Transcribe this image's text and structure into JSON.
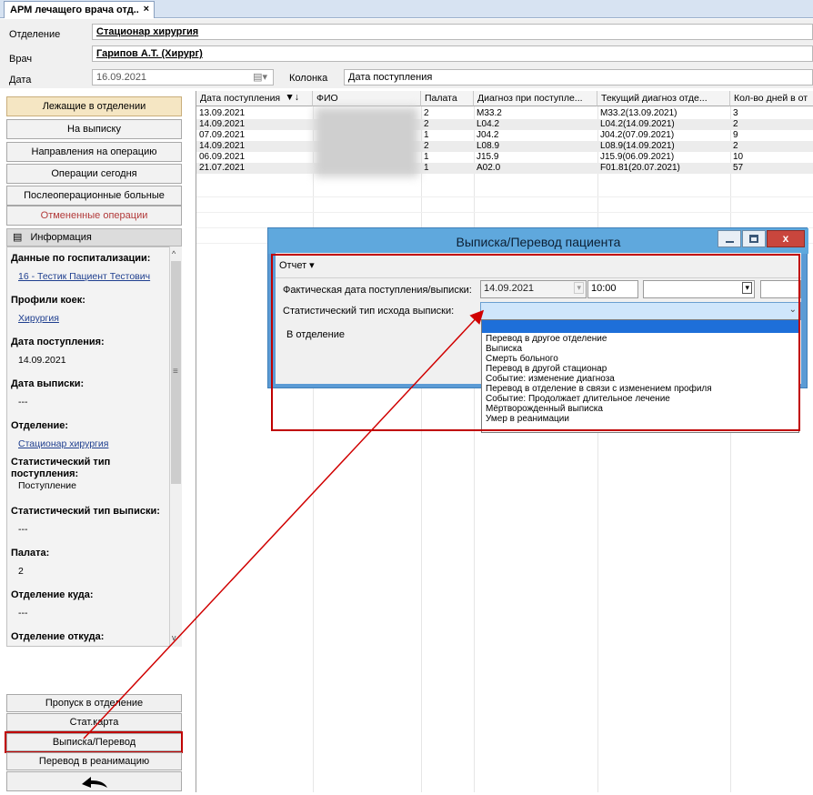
{
  "tab": {
    "title": "АРМ лечащего врача отд..",
    "close": "×"
  },
  "header": {
    "department_label": "Отделение",
    "department_value": "Стационар хирургия",
    "doctor_label": "Врач",
    "doctor_value": "Гарипов А.Т. (Хирург)",
    "date_label": "Дата",
    "date_value": "16.09.2021",
    "column_label": "Колонка",
    "column_value": "Дата поступления"
  },
  "nav": [
    {
      "label": "Лежащие в отделении",
      "state": "active"
    },
    {
      "label": "На выписку"
    },
    {
      "label": "Направления на операцию"
    },
    {
      "label": "Операции сегодня"
    },
    {
      "label": "Послеоперационные больные"
    },
    {
      "label": "Отмененные операции",
      "state": "red"
    }
  ],
  "info": {
    "title": "Информация",
    "fields": [
      {
        "label": "Данные по госпитализации:",
        "value": "16 - Тестик Пациент Тестович",
        "link": true
      },
      {
        "label": "Профили коек:",
        "value": "Хирургия",
        "link": true
      },
      {
        "label": "Дата поступления:",
        "value": "14.09.2021"
      },
      {
        "label": "Дата выписки:",
        "value": "---"
      },
      {
        "label": "Отделение:",
        "value": "Стационар хирургия",
        "link": true
      },
      {
        "label": "Статистический тип поступления:",
        "value": "Поступление"
      },
      {
        "label": "Статистический тип выписки:",
        "value": "---"
      },
      {
        "label": "Палата:",
        "value": "2"
      },
      {
        "label": "Отделение куда:",
        "value": "---"
      },
      {
        "label": "Отделение откуда:",
        "value": ""
      }
    ]
  },
  "bottom_buttons": [
    {
      "label": "Пропуск в отделение"
    },
    {
      "label": "Стат.карта"
    },
    {
      "label": "Выписка/Перевод"
    },
    {
      "label": "Перевод в реанимацию"
    }
  ],
  "grid": {
    "columns": [
      "Дата поступления",
      "ФИО",
      "Палата",
      "Диагноз при поступле...",
      "Текущий диагноз отде...",
      "Кол-во дней в от"
    ],
    "rows": [
      [
        "13.09.2021",
        "",
        "2",
        "M33.2",
        "M33.2(13.09.2021)",
        "3"
      ],
      [
        "14.09.2021",
        "",
        "2",
        "L04.2",
        "L04.2(14.09.2021)",
        "2"
      ],
      [
        "07.09.2021",
        "",
        "1",
        "J04.2",
        "J04.2(07.09.2021)",
        "9"
      ],
      [
        "14.09.2021",
        "",
        "2",
        "L08.9",
        "L08.9(14.09.2021)",
        "2"
      ],
      [
        "06.09.2021",
        "",
        "1",
        "J15.9",
        "J15.9(06.09.2021)",
        "10"
      ],
      [
        "21.07.2021",
        "",
        "1",
        "A02.0",
        "F01.81(20.07.2021)",
        "57"
      ]
    ]
  },
  "dialog": {
    "title": "Выписка/Перевод пациента",
    "menu": "Отчет ▾",
    "date_label": "Фактическая дата поступления/выписки:",
    "date_value": "14.09.2021",
    "time_value": "10:00",
    "type_label": "Статистический тип исхода выписки:",
    "dept_label": "В отделение",
    "options": [
      "Перевод в другое отделение",
      "Выписка",
      "Смерть больного",
      "Перевод в другой стационар",
      "Событие: изменение диагноза",
      "Перевод в отделение в связи с изменением профиля",
      "Событие: Продолжает длительное лечение",
      "Мёртворожденный выписка",
      "Умер в реанимации"
    ]
  },
  "colors": {
    "accent_red": "#c00000",
    "dialog_title": "#5fa8dd",
    "nav_active": "#f5e6c3"
  }
}
